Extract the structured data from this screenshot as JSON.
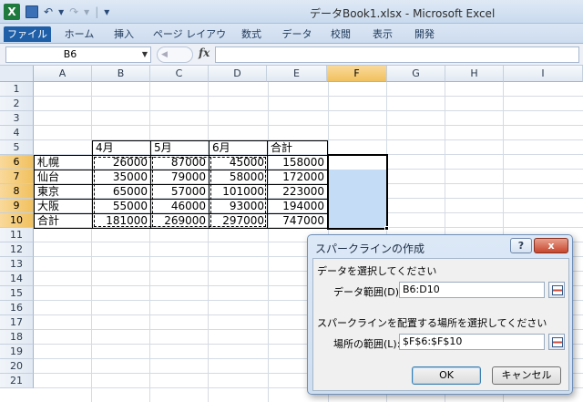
{
  "window": {
    "title": "データBook1.xlsx - Microsoft Excel",
    "app_icon": "X"
  },
  "qat": {
    "undo_icon": "↶",
    "redo_icon": "↷",
    "sep": "|",
    "more": "▾"
  },
  "ribbon": {
    "tabs": [
      "ファイル",
      "ホーム",
      "挿入",
      "ページ レイアウト",
      "数式",
      "データ",
      "校閲",
      "表示",
      "開発"
    ]
  },
  "formula_bar": {
    "name_box": "B6",
    "fx": "fx",
    "formula": ""
  },
  "sheet": {
    "columns": [
      "A",
      "B",
      "C",
      "D",
      "E",
      "F",
      "G",
      "H",
      "I"
    ],
    "rows": [
      "1",
      "2",
      "3",
      "4",
      "5",
      "6",
      "7",
      "8",
      "9",
      "10",
      "11",
      "12",
      "13",
      "14",
      "15",
      "16",
      "17",
      "18",
      "19",
      "20",
      "21"
    ],
    "header_row": {
      "b": "4月",
      "c": "5月",
      "d": "6月",
      "e": "合計"
    },
    "data_rows": [
      {
        "a": "札幌",
        "b": "26000",
        "c": "87000",
        "d": "45000",
        "e": "158000"
      },
      {
        "a": "仙台",
        "b": "35000",
        "c": "79000",
        "d": "58000",
        "e": "172000"
      },
      {
        "a": "東京",
        "b": "65000",
        "c": "57000",
        "d": "101000",
        "e": "223000"
      },
      {
        "a": "大阪",
        "b": "55000",
        "c": "46000",
        "d": "93000",
        "e": "194000"
      },
      {
        "a": "合計",
        "b": "181000",
        "c": "269000",
        "d": "297000",
        "e": "747000"
      }
    ]
  },
  "dialog": {
    "title": "スパークラインの作成",
    "help": "?",
    "close": "x",
    "data_section": "データを選択してください",
    "data_range_label": "データ範囲(D):",
    "data_range_value": "B6:D10",
    "location_section": "スパークラインを配置する場所を選択してください",
    "location_label": "場所の範囲(L):",
    "location_value": "$F$6:$F$10",
    "ok": "OK",
    "cancel": "キャンセル"
  }
}
